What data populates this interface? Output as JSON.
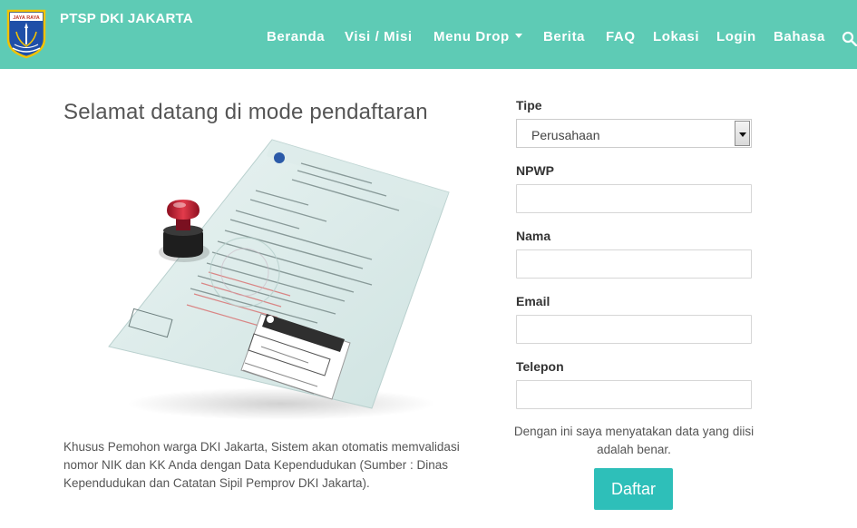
{
  "header": {
    "brand": "PTSP DKI JAKARTA",
    "logo_text": "JAYA RAYA",
    "nav": [
      {
        "label": "Beranda"
      },
      {
        "label": "Visi / Misi"
      },
      {
        "label": "Menu Drop"
      },
      {
        "label": "Berita"
      },
      {
        "label": "FAQ"
      },
      {
        "label": "Lokasi"
      },
      {
        "label": "Login"
      },
      {
        "label": "Bahasa"
      }
    ],
    "search_icon": "search-icon"
  },
  "main": {
    "title": "Selamat datang di mode pendaftaran",
    "info_text": "Khusus Pemohon warga DKI Jakarta, Sistem akan otomatis memvalidasi nomor NIK dan KK Anda dengan Data Kependudukan (Sumber : Dinas Kependudukan dan Catatan Sipil Pemprov DKI Jakarta)."
  },
  "form": {
    "tipe_label": "Tipe",
    "tipe_value": "Perusahaan",
    "npwp_label": "NPWP",
    "npwp_value": "",
    "nama_label": "Nama",
    "nama_value": "",
    "email_label": "Email",
    "email_value": "",
    "telepon_label": "Telepon",
    "telepon_value": "",
    "consent": "Dengan ini saya menyatakan data yang diisi adalah benar.",
    "submit_label": "Daftar"
  },
  "colors": {
    "navbar": "#5ecbb5",
    "button": "#2ebfb9"
  }
}
